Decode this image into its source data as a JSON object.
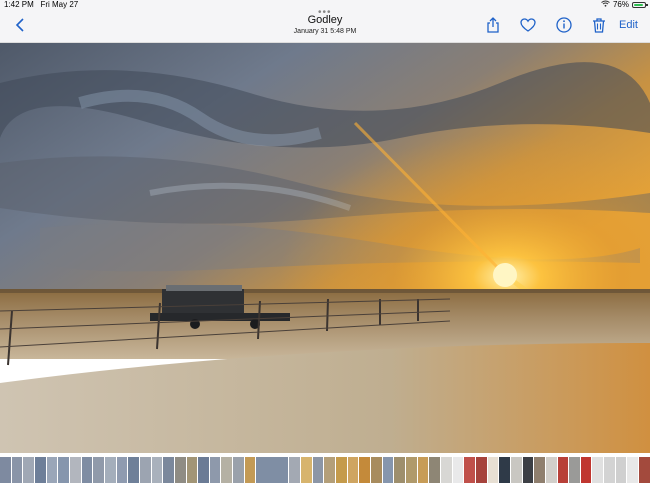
{
  "status": {
    "time": "1:42 PM",
    "date": "Fri May 27",
    "battery": "76%"
  },
  "nav": {
    "title": "Godley",
    "subtitle": "January 31  5:48 PM",
    "edit_label": "Edit"
  },
  "colors": {
    "accent": "#1f62c9"
  },
  "icons": [
    "chevron-left-icon",
    "share-icon",
    "heart-icon",
    "info-icon",
    "trash-icon"
  ],
  "thumbnails": [
    "#7e8aa0",
    "#8a95a8",
    "#a0a8b5",
    "#6e7f99",
    "#9aa6b8",
    "#8696ad",
    "#b2b6be",
    "#7f8da3",
    "#909aaa",
    "#a4aebb",
    "#8f9bb0",
    "#6f8099",
    "#9ca4b1",
    "#a9b1bc",
    "#7b889c",
    "#8f8c84",
    "#a29576",
    "#6b7b95",
    "#8e99ab",
    "#b5b1a4",
    "#9aa1ab",
    "#c39a55",
    "#7f8ea4",
    "#a3a9b3",
    "#d7b46d",
    "#8c96a6",
    "#b49f79",
    "#c59b4b",
    "#cfa561",
    "#c48a3a",
    "#a88c5e",
    "#8696ad",
    "#9e8f6d",
    "#b09a6b",
    "#c79c57",
    "#8e8675",
    "#d8d7d4",
    "#e9e9ea",
    "#c0504a",
    "#a6433c",
    "#e7dfd3",
    "#2f3a48",
    "#c9c7c2",
    "#3c3f45",
    "#8f7f6e",
    "#d2cfca",
    "#b84038",
    "#9a9a98",
    "#c0362f",
    "#e0e0e0",
    "#d3d3d3",
    "#cfcfcf",
    "#e8e8e8",
    "#a34a3d"
  ]
}
